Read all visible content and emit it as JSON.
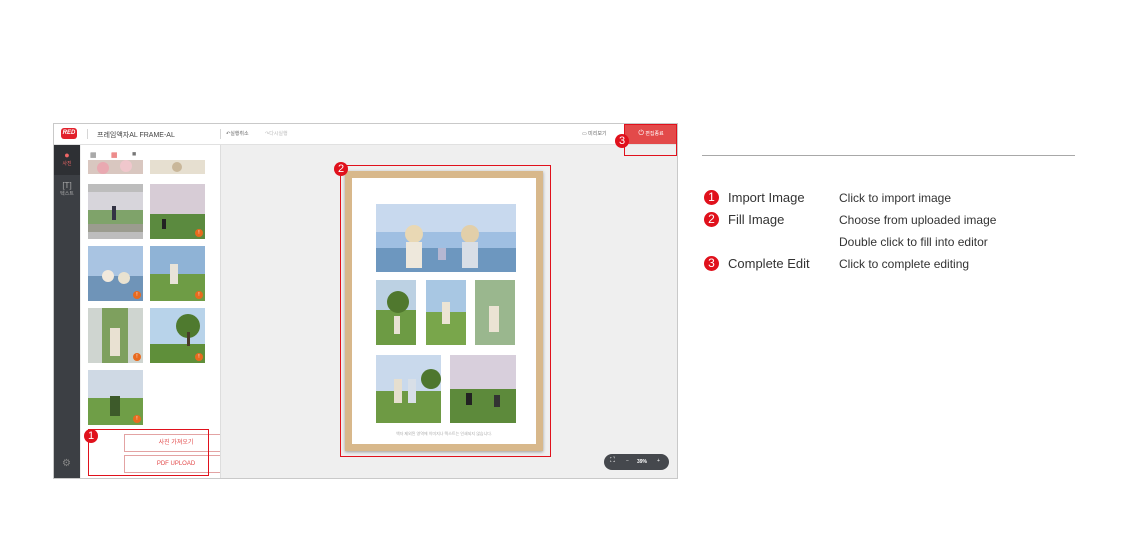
{
  "editor": {
    "logo": "RED",
    "title": "프레임액자AL FRAME-AL",
    "undo": "실행취소",
    "redo": "다시실행",
    "preview": "미리보기",
    "finish": "편집종료",
    "rail": {
      "photo": "사진",
      "text": "텍스트"
    },
    "panel": {
      "import_button": "사진 가져오기",
      "pdf_button": "PDF UPLOAD",
      "badge": "!"
    },
    "canvas": {
      "caption": "액자 제외된 영역에 이미지나 텍스트는 인쇄되지 않습니다."
    },
    "zoom": {
      "level": "39%",
      "minus": "−",
      "plus": "+"
    }
  },
  "callouts": [
    "1",
    "2",
    "3"
  ],
  "legend": [
    {
      "num": "1",
      "name": "Import Image",
      "desc": "Click to import image"
    },
    {
      "num": "2",
      "name": "Fill Image",
      "desc": "Choose from uploaded image"
    },
    {
      "desc2": "Double click to fill into editor"
    },
    {
      "num": "3",
      "name": "Complete Edit",
      "desc": "Click to complete editing"
    }
  ],
  "colors": {
    "accent": "#e0111c",
    "finish_button": "#e34a4a",
    "frame": "#d8b88b"
  },
  "icons": [
    "undo-icon",
    "redo-icon",
    "monitor-icon",
    "power-icon",
    "camera-icon",
    "text-icon",
    "gear-icon",
    "grid-small-icon",
    "grid-medium-icon",
    "grid-large-icon",
    "fit-icon"
  ]
}
